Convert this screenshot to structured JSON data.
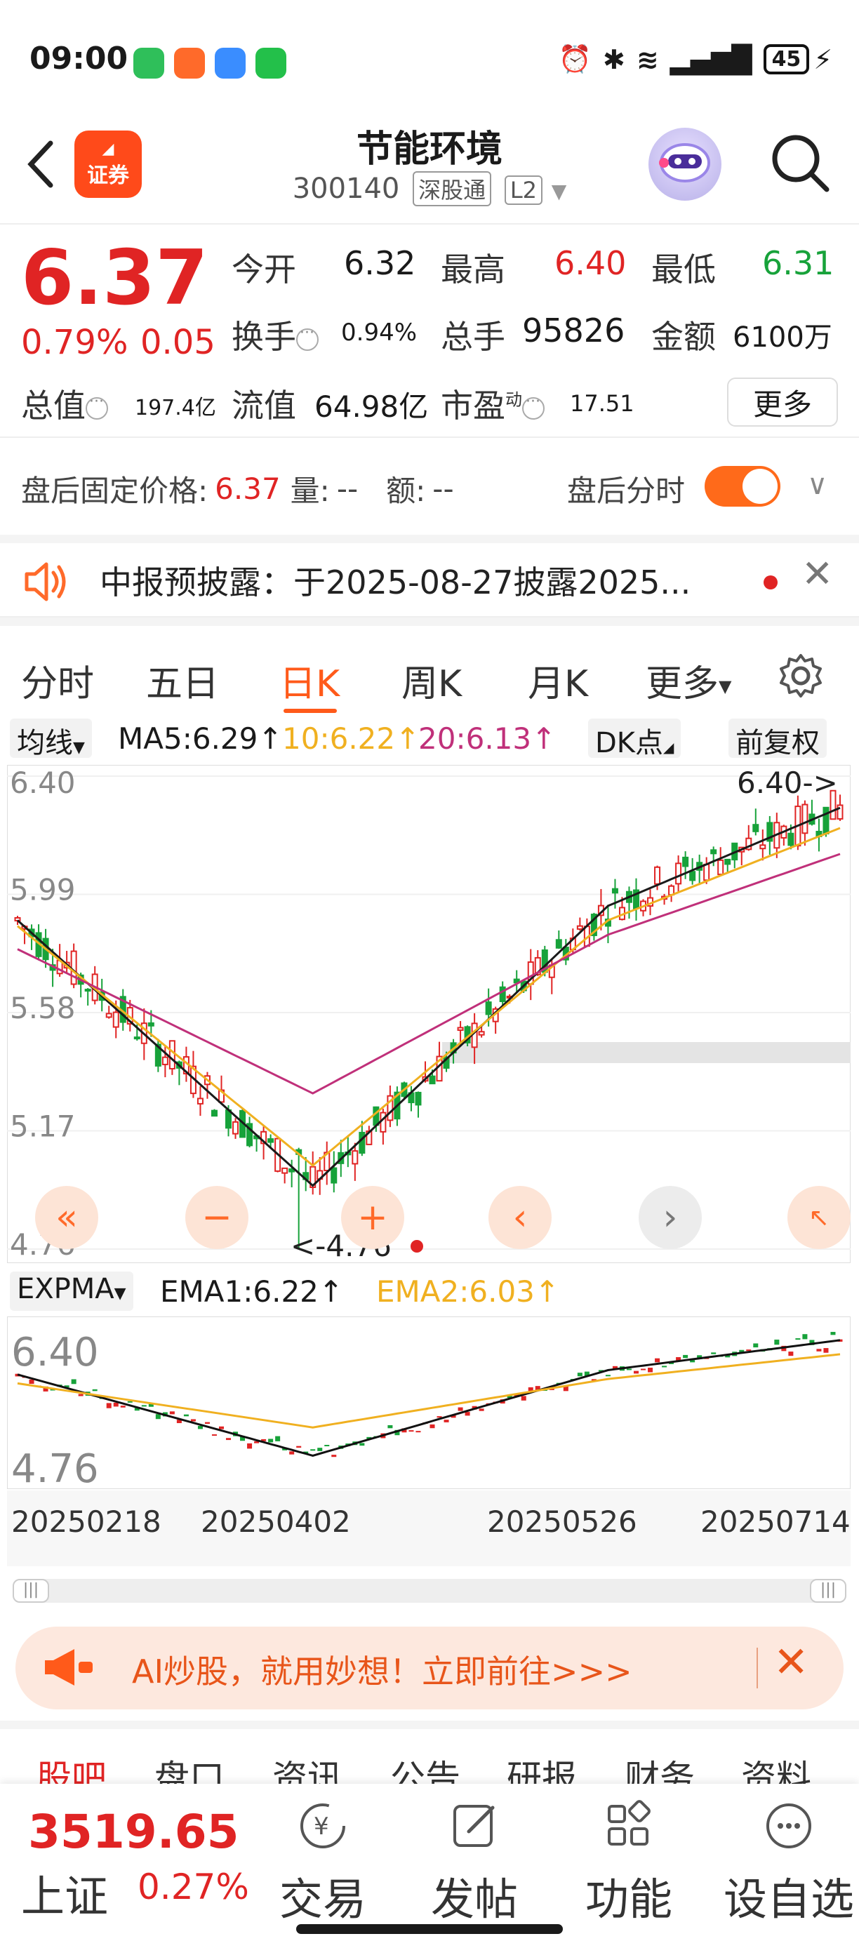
{
  "status_bar": {
    "time": "09:00",
    "battery": "45"
  },
  "header": {
    "stock_name": "节能环境",
    "stock_code": "300140",
    "tag_channel": "深股通",
    "tag_level": "L2",
    "logo_text": "证券"
  },
  "quote": {
    "price": "6.37",
    "change_pct": "0.79%",
    "change_val": "0.05",
    "open_label": "今开",
    "open": "6.32",
    "high_label": "最高",
    "high": "6.40",
    "low_label": "最低",
    "low": "6.31",
    "turnover_label": "换手",
    "turnover": "0.94%",
    "volume_label": "总手",
    "volume": "95826",
    "amount_label": "金额",
    "amount": "6100万",
    "mcap_label": "总值",
    "mcap": "197.4亿",
    "float_label": "流值",
    "float": "64.98亿",
    "pe_label": "市盈",
    "pe_sup": "动",
    "pe": "17.51",
    "more": "更多"
  },
  "after_hours": {
    "label": "盘后固定价格:",
    "price": "6.37",
    "vol_label": "量:",
    "vol": "--",
    "amt_label": "额:",
    "amt": "--",
    "toggle_label": "盘后分时",
    "toggle_on": true
  },
  "notice": {
    "text": "中报预披露：于2025-08-27披露2025..."
  },
  "tabs": {
    "items": [
      "分时",
      "五日",
      "日K",
      "周K",
      "月K",
      "更多"
    ],
    "active": "日K"
  },
  "chart_toolbar": {
    "indicator": "均线",
    "ma5": "MA5:6.29↑",
    "ma10": "10:6.22↑",
    "ma20": "20:6.13↑",
    "dk": "DK点",
    "adjust": "前复权"
  },
  "sub_toolbar": {
    "indicator": "EXPMA",
    "ema1": "EMA1:6.22↑",
    "ema2": "EMA2:6.03↑"
  },
  "chart_labels": {
    "y_ticks": [
      "6.40",
      "5.99",
      "5.58",
      "5.17",
      "4.76"
    ],
    "high_marker": "6.40->",
    "low_marker": "<-4.76",
    "sub_y_ticks": [
      "6.40",
      "4.76"
    ],
    "dates": [
      "20250218",
      "20250402",
      "20250526",
      "20250714"
    ]
  },
  "chart_data": {
    "type": "line",
    "title": "",
    "x": [
      "20250218",
      "20250402",
      "20250526",
      "20250714"
    ],
    "ylim": [
      4.76,
      6.4
    ],
    "series": [
      {
        "name": "MA5",
        "values": [
          5.9,
          4.98,
          5.95,
          6.29
        ]
      },
      {
        "name": "10",
        "values": [
          5.88,
          5.05,
          5.9,
          6.22
        ]
      },
      {
        "name": "20",
        "values": [
          5.8,
          5.3,
          5.85,
          6.13
        ]
      }
    ]
  },
  "ai_banner": {
    "text": "AI炒股，就用妙想！立即前往>>>"
  },
  "bottom_tabs": [
    "股吧",
    "盘口",
    "资讯",
    "公告",
    "研报",
    "财务",
    "资料"
  ],
  "dock": {
    "index_value": "3519.65",
    "index_name": "上证",
    "index_pct": "0.27%",
    "items": [
      "交易",
      "发帖",
      "功能",
      "设自选"
    ]
  },
  "colors": {
    "up": "#e02424",
    "down": "#17a23a",
    "accent": "#ff5a1a",
    "ma5": "#1a1a1a",
    "ma10": "#f0b020",
    "ma20": "#c0307a"
  }
}
